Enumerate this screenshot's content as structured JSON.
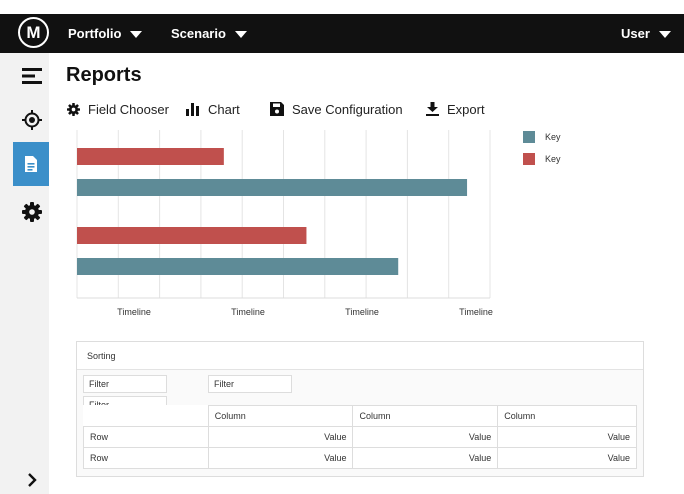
{
  "topbar": {
    "logo_glyph": "M",
    "menus": [
      "Portfolio",
      "Scenario"
    ],
    "user_label": "User"
  },
  "sidebar": {
    "items": [
      {
        "name": "menu",
        "icon": "hamburger-icon"
      },
      {
        "name": "target",
        "icon": "crosshair-icon"
      },
      {
        "name": "reports",
        "icon": "document-icon",
        "active": true
      },
      {
        "name": "settings",
        "icon": "gear-icon"
      }
    ],
    "expand_icon": "chevron-right-icon",
    "active_color": "#3b8fc9"
  },
  "page": {
    "title": "Reports"
  },
  "toolbar": {
    "field_chooser": "Field Chooser",
    "chart": "Chart",
    "save_configuration": "Save Configuration",
    "export": "Export"
  },
  "chart_data": {
    "type": "bar",
    "orientation": "horizontal",
    "categories": [
      "",
      ""
    ],
    "series": [
      {
        "name": "Key",
        "color": "#5e8b97",
        "values": [
          0.85,
          0.7
        ]
      },
      {
        "name": "Key",
        "color": "#c0504d",
        "values": [
          0.32,
          0.5
        ]
      }
    ],
    "x_tick_labels": [
      "Timeline",
      "Timeline",
      "Timeline",
      "Timeline"
    ],
    "xlim": [
      0,
      0.9
    ],
    "grid": true,
    "legend": "top-right"
  },
  "pivot": {
    "sorting_label": "Sorting",
    "filters": [
      "Filter",
      "Filter",
      "Filter"
    ],
    "columns": [
      "Column",
      "Column",
      "Column"
    ],
    "rows": [
      {
        "label": "Row",
        "values": [
          "Value",
          "Value",
          "Value"
        ]
      },
      {
        "label": "Row",
        "values": [
          "Value",
          "Value",
          "Value"
        ]
      }
    ]
  }
}
